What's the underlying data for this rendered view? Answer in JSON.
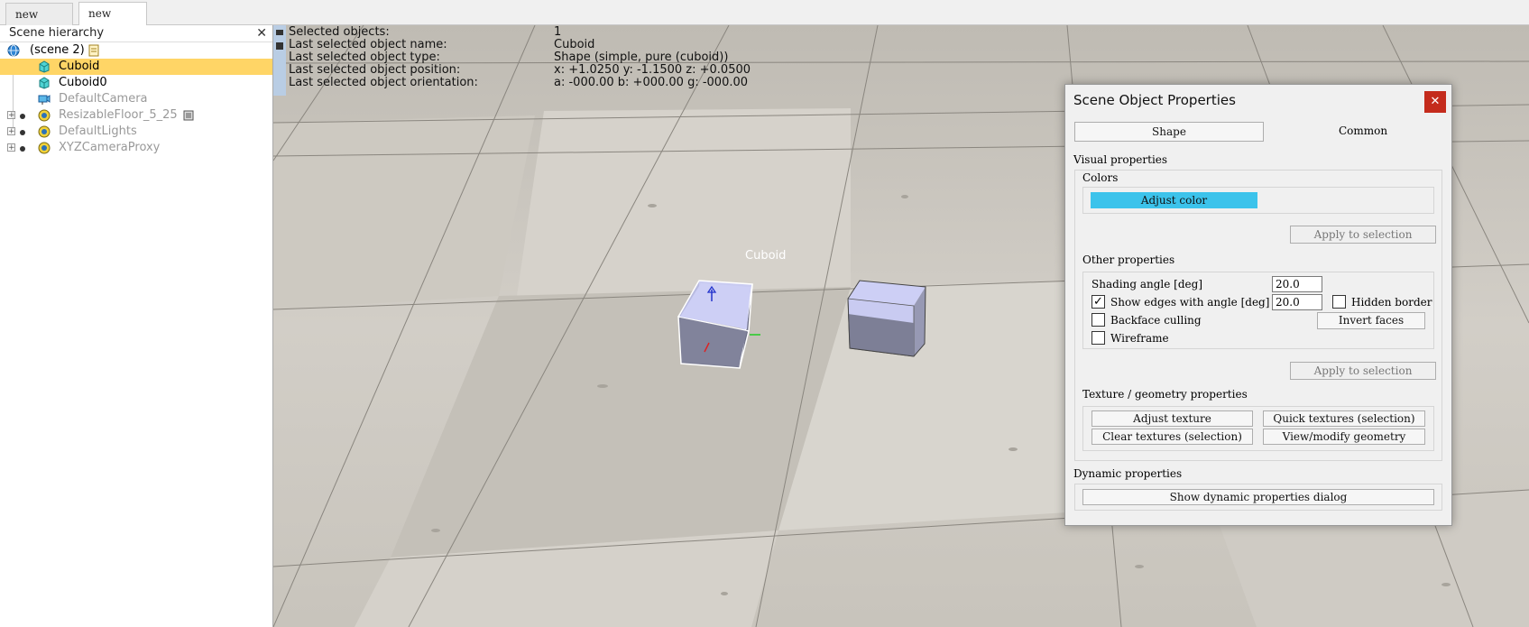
{
  "tabs": [
    {
      "label": "new scene"
    },
    {
      "label": "new scene"
    }
  ],
  "hierarchy": {
    "title": "Scene hierarchy",
    "close": "✕",
    "scene": "(scene 2)",
    "items": [
      {
        "label": "Cuboid"
      },
      {
        "label": "Cuboid0"
      },
      {
        "label": "DefaultCamera"
      },
      {
        "label": "ResizableFloor_5_25"
      },
      {
        "label": "DefaultLights"
      },
      {
        "label": "XYZCameraProxy"
      }
    ]
  },
  "info": {
    "rows": [
      {
        "key": "Selected objects:",
        "value": "1"
      },
      {
        "key": "Last selected object name:",
        "value": "Cuboid"
      },
      {
        "key": "Last selected object type:",
        "value": "Shape (simple, pure (cuboid))"
      },
      {
        "key": "Last selected object position:",
        "value": "x: +1.0250    y: -1.1500    z: +0.0500"
      },
      {
        "key": "Last selected object orientation:",
        "value": "a: -000.00    b: +000.00    g: -000.00"
      }
    ]
  },
  "scene_label": "Cuboid",
  "dialog": {
    "title": "Scene Object Properties",
    "close": "✕",
    "tab_shape": "Shape",
    "tab_common": "Common",
    "visual_properties": "Visual properties",
    "colors": "Colors",
    "adjust_color": "Adjust color",
    "apply_to_selection_1": "Apply to selection",
    "other_properties": "Other properties",
    "shading_angle": "Shading angle [deg]",
    "shading_angle_value": "20.0",
    "show_edges": "Show edges with angle [deg]",
    "show_edges_value": "20.0",
    "hidden_border": "Hidden border",
    "backface_culling": "Backface culling",
    "invert_faces": "Invert faces",
    "wireframe": "Wireframe",
    "apply_to_selection_2": "Apply to selection",
    "texture_geometry": "Texture / geometry properties",
    "adjust_texture": "Adjust texture",
    "quick_textures": "Quick textures (selection)",
    "clear_textures": "Clear textures (selection)",
    "view_modify_geometry": "View/modify geometry",
    "dynamic_properties": "Dynamic properties",
    "show_dynamic_dialog": "Show dynamic properties dialog",
    "check_mark": "✓",
    "accent_color": "#3cc3eb"
  }
}
